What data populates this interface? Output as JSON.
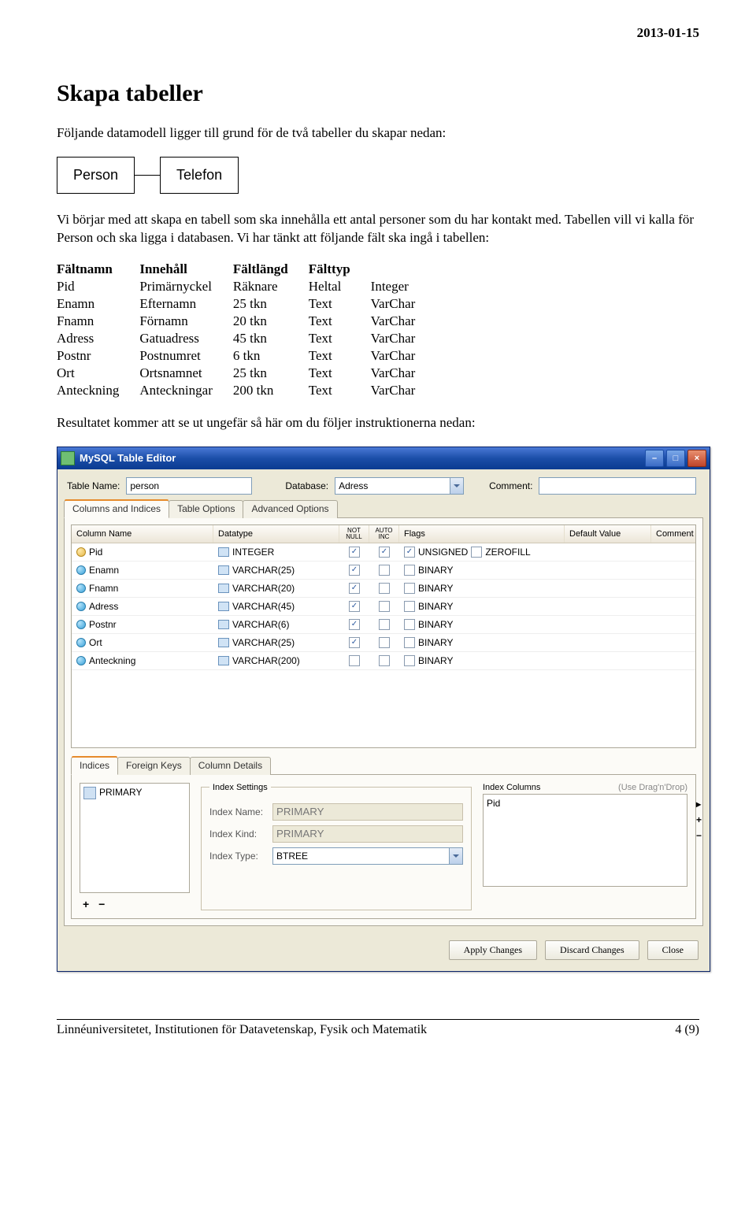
{
  "header": {
    "date": "2013-01-15"
  },
  "title": "Skapa tabeller",
  "intro": "Följande datamodell ligger till grund för de två tabeller du skapar nedan:",
  "erd": {
    "left": "Person",
    "right": "Telefon"
  },
  "para2": "Vi börjar med att skapa en tabell som ska innehålla ett antal personer som du har kontakt med. Tabellen vill vi kalla för Person och ska ligga i databasen. Vi har tänkt att följande fält ska ingå i tabellen:",
  "field_table": {
    "headers": [
      "Fältnamn",
      "Innehåll",
      "Fältlängd",
      "Fälttyp",
      ""
    ],
    "rows": [
      [
        "Pid",
        "Primärnyckel",
        "Räknare",
        "Heltal",
        "Integer"
      ],
      [
        "Enamn",
        "Efternamn",
        "25 tkn",
        "Text",
        "VarChar"
      ],
      [
        "Fnamn",
        "Förnamn",
        "20 tkn",
        "Text",
        "VarChar"
      ],
      [
        "Adress",
        "Gatuadress",
        "45 tkn",
        "Text",
        "VarChar"
      ],
      [
        "Postnr",
        "Postnumret",
        "6 tkn",
        "Text",
        "VarChar"
      ],
      [
        "Ort",
        "Ortsnamnet",
        "25 tkn",
        "Text",
        "VarChar"
      ],
      [
        "Anteckning",
        "Anteckningar",
        "200 tkn",
        "Text",
        "VarChar"
      ]
    ]
  },
  "result_text": "Resultatet kommer att se ut ungefär så här om du följer instruktionerna nedan:",
  "app": {
    "title": "MySQL Table Editor",
    "toolbar": {
      "table_name_label": "Table Name:",
      "table_name_value": "person",
      "database_label": "Database:",
      "database_value": "Adress",
      "comment_label": "Comment:",
      "comment_value": ""
    },
    "tabs": {
      "t1": "Columns and Indices",
      "t2": "Table Options",
      "t3": "Advanced Options"
    },
    "grid": {
      "heads": {
        "name": "Column Name",
        "dtype": "Datatype",
        "nn": "NOT NULL",
        "ai": "AUTO INC",
        "flags": "Flags",
        "def": "Default Value",
        "comment": "Comment"
      },
      "rows": [
        {
          "icon": "key",
          "name": "Pid",
          "dtype": "INTEGER",
          "nn": true,
          "ai": true,
          "flags": [
            {
              "label": "UNSIGNED",
              "checked": true
            },
            {
              "label": "ZEROFILL",
              "checked": false
            }
          ]
        },
        {
          "icon": "col",
          "name": "Enamn",
          "dtype": "VARCHAR(25)",
          "nn": true,
          "ai": false,
          "flags": [
            {
              "label": "BINARY",
              "checked": false
            }
          ]
        },
        {
          "icon": "col",
          "name": "Fnamn",
          "dtype": "VARCHAR(20)",
          "nn": true,
          "ai": false,
          "flags": [
            {
              "label": "BINARY",
              "checked": false
            }
          ]
        },
        {
          "icon": "col",
          "name": "Adress",
          "dtype": "VARCHAR(45)",
          "nn": true,
          "ai": false,
          "flags": [
            {
              "label": "BINARY",
              "checked": false
            }
          ]
        },
        {
          "icon": "col",
          "name": "Postnr",
          "dtype": "VARCHAR(6)",
          "nn": true,
          "ai": false,
          "flags": [
            {
              "label": "BINARY",
              "checked": false
            }
          ]
        },
        {
          "icon": "col",
          "name": "Ort",
          "dtype": "VARCHAR(25)",
          "nn": true,
          "ai": false,
          "flags": [
            {
              "label": "BINARY",
              "checked": false
            }
          ]
        },
        {
          "icon": "col",
          "name": "Anteckning",
          "dtype": "VARCHAR(200)",
          "nn": false,
          "ai": false,
          "flags": [
            {
              "label": "BINARY",
              "checked": false
            }
          ]
        }
      ]
    },
    "subtabs": {
      "t1": "Indices",
      "t2": "Foreign Keys",
      "t3": "Column Details"
    },
    "index_list": "PRIMARY",
    "index_settings": {
      "legend": "Index Settings",
      "name_label": "Index Name:",
      "name_value": "PRIMARY",
      "kind_label": "Index Kind:",
      "kind_value": "PRIMARY",
      "type_label": "Index Type:",
      "type_value": "BTREE"
    },
    "index_columns": {
      "header": "Index Columns",
      "hint": "(Use Drag'n'Drop)",
      "row": "Pid"
    },
    "buttons": {
      "apply": "Apply Changes",
      "discard": "Discard Changes",
      "close": "Close"
    }
  },
  "footer": {
    "left": "Linnéuniversitetet, Institutionen för Datavetenskap, Fysik och Matematik",
    "right": "4 (9)"
  }
}
